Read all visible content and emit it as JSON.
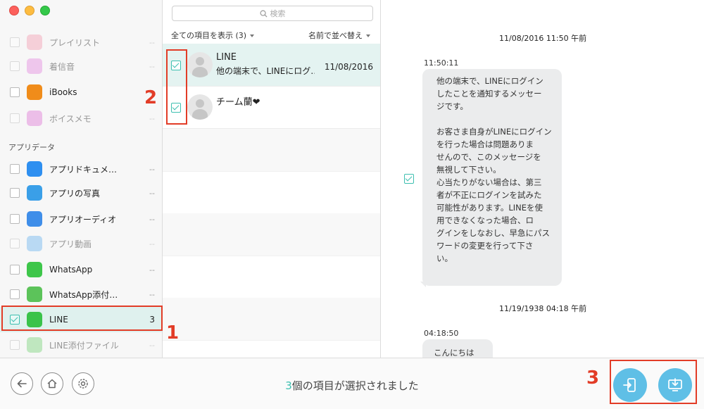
{
  "window": {
    "search_placeholder": "検索"
  },
  "sidebar": {
    "items_top": [
      {
        "label": "プレイリスト",
        "count": "--",
        "enabled": false,
        "icon": "playlist-icon",
        "color": "#f3a0b4"
      },
      {
        "label": "着信音",
        "count": "--",
        "enabled": false,
        "icon": "bell-icon",
        "color": "#e58be0"
      },
      {
        "label": "iBooks",
        "count": "--",
        "enabled": true,
        "icon": "ibooks-icon",
        "color": "#f08c1a"
      },
      {
        "label": "ボイスメモ",
        "count": "--",
        "enabled": false,
        "icon": "microphone-icon",
        "color": "#e07bd6"
      }
    ],
    "section_label": "アプリデータ",
    "items_apps": [
      {
        "label": "アプリドキュメ…",
        "count": "--",
        "enabled": true,
        "icon": "document-icon",
        "color": "#2e8ff0"
      },
      {
        "label": "アプリの写真",
        "count": "--",
        "enabled": true,
        "icon": "photo-icon",
        "color": "#3a9fe8"
      },
      {
        "label": "アプリオーディオ",
        "count": "--",
        "enabled": true,
        "icon": "speaker-icon",
        "color": "#3f8ee9"
      },
      {
        "label": "アプリ動画",
        "count": "--",
        "enabled": false,
        "icon": "video-icon",
        "color": "#6fb6f0"
      },
      {
        "label": "WhatsApp",
        "count": "--",
        "enabled": true,
        "icon": "whatsapp-icon",
        "color": "#3ec64a"
      },
      {
        "label": "WhatsApp添付…",
        "count": "--",
        "enabled": true,
        "icon": "whatsapp-attach-icon",
        "color": "#5cc35a"
      },
      {
        "label": "LINE",
        "count": "3",
        "enabled": true,
        "selected": true,
        "checked": true,
        "icon": "line-icon",
        "color": "#3ac34a"
      },
      {
        "label": "LINE添付ファイル",
        "count": "--",
        "enabled": false,
        "icon": "line-attach-icon",
        "color": "#7cd47d"
      }
    ]
  },
  "list": {
    "filter_label": "全ての項目を表示 (3)",
    "sort_label": "名前で並べ替え",
    "rows": [
      {
        "name": "LINE",
        "preview": "他の端末で、LINEにログ…",
        "date": "11/08/2016",
        "selected": true
      },
      {
        "name": "チーム蘭❤",
        "preview": "",
        "date": "",
        "selected": false
      }
    ]
  },
  "conversation": {
    "date1": "11/08/2016 11:50 午前",
    "time1": "11:50:11",
    "bubble1": "他の端末で、LINEにログイン\nしたことを通知するメッセー\nジです。\n\nお客さま自身がLINEにログイン\nを行った場合は問題ありま\nせんので、このメッセージを\n無視して下さい。\n心当たりがない場合は、第三\n者が不正にログインを試みた\n可能性があります。LINEを使\n用できなくなった場合、ロ\nグインをしなおし、早急にパス\nワードの変更を行って下さ\nい。",
    "date2": "11/19/1938 04:18 午前",
    "time2": "04:18:50",
    "bubble2": "こんにちは"
  },
  "bottom": {
    "status_count": "3",
    "status_text": "個の項目が選択されました"
  },
  "annotations": {
    "n1": "1",
    "n2": "2",
    "n3": "3"
  },
  "colors": {
    "accent": "#3dbfb0",
    "annotation_red": "#e23c27",
    "action_button": "#5fbfe6"
  }
}
